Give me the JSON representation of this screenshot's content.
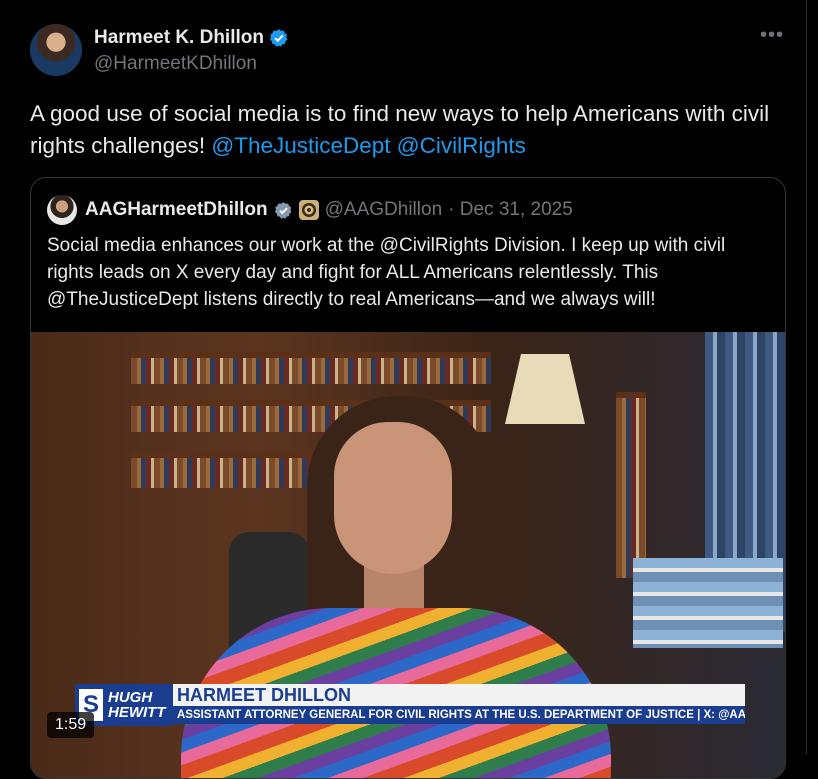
{
  "post": {
    "author_name": "Harmeet K. Dhillon",
    "author_handle": "@HarmeetKDhillon",
    "more_icon": "more-icon",
    "text": "A good use of social media is to find new ways to help Americans with civil rights challenges! ",
    "mentions": [
      "@TheJusticeDept",
      "@CivilRights"
    ]
  },
  "quote": {
    "author_name": "AAGHarmeetDhillon",
    "author_handle": "@AAGDhillon",
    "date": "· Dec 31, 2025",
    "text": "Social media enhances our work at the @CivilRights Division. I keep up with civil rights leads on X every day and fight for ALL Americans relentlessly. This @TheJusticeDept listens directly to real Americans—and we always will!",
    "video": {
      "duration": "1:59",
      "lower_third": {
        "logo_letter": "S",
        "show_name_line1": "HUGH",
        "show_name_line2": "HEWITT",
        "name": "HARMEET DHILLON",
        "subtitle": "ASSISTANT ATTORNEY GENERAL FOR CIVIL RIGHTS AT THE U.S. DEPARTMENT OF JUSTICE | X: @AAGDHILLON"
      }
    }
  },
  "colors": {
    "background": "#000000",
    "text": "#e7e9ea",
    "secondary": "#71767b",
    "link": "#1d9bf0",
    "verified": "#1d9bf0"
  }
}
